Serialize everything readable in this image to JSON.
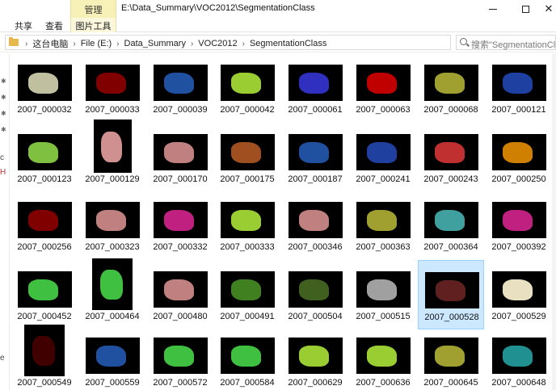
{
  "window": {
    "title": "E:\\Data_Summary\\VOC2012\\SegmentationClass",
    "contextual_group": "管理"
  },
  "ribbon": {
    "tabs": [
      "共享",
      "查看"
    ],
    "contextual_tab": "图片工具"
  },
  "address": {
    "crumbs": [
      "这台电脑",
      "File (E:)",
      "Data_Summary",
      "VOC2012",
      "SegmentationClass"
    ],
    "search_placeholder": "搜索\"SegmentationCla..."
  },
  "left_nav": {
    "fragments": [
      "c",
      "H",
      "e"
    ]
  },
  "files": [
    {
      "name": "2007_000032",
      "thumb": "wide",
      "accent": "#c0c0a0"
    },
    {
      "name": "2007_000033",
      "thumb": "wide",
      "accent": "#800000"
    },
    {
      "name": "2007_000039",
      "thumb": "wide",
      "accent": "#2050a0"
    },
    {
      "name": "2007_000042",
      "thumb": "wide",
      "accent": "#9acd32"
    },
    {
      "name": "2007_000061",
      "thumb": "wide",
      "accent": "#3030c0"
    },
    {
      "name": "2007_000063",
      "thumb": "wide",
      "accent": "#c00000"
    },
    {
      "name": "2007_000068",
      "thumb": "wide",
      "accent": "#a0a030"
    },
    {
      "name": "2007_000121",
      "thumb": "wide",
      "accent": "#1e40a0"
    },
    {
      "name": "2007_000123",
      "thumb": "wide",
      "accent": "#80c040"
    },
    {
      "name": "2007_000129",
      "thumb": "tall",
      "accent": "#d09090"
    },
    {
      "name": "2007_000170",
      "thumb": "wide",
      "accent": "#c08080"
    },
    {
      "name": "2007_000175",
      "thumb": "wide",
      "accent": "#a05020"
    },
    {
      "name": "2007_000187",
      "thumb": "wide",
      "accent": "#2050a0"
    },
    {
      "name": "2007_000241",
      "thumb": "wide",
      "accent": "#2040a0"
    },
    {
      "name": "2007_000243",
      "thumb": "wide",
      "accent": "#c03030"
    },
    {
      "name": "2007_000250",
      "thumb": "wide",
      "accent": "#d08000"
    },
    {
      "name": "2007_000256",
      "thumb": "wide",
      "accent": "#800000"
    },
    {
      "name": "2007_000323",
      "thumb": "wide",
      "accent": "#c08080"
    },
    {
      "name": "2007_000332",
      "thumb": "wide",
      "accent": "#c02080"
    },
    {
      "name": "2007_000333",
      "thumb": "wide",
      "accent": "#9acd32"
    },
    {
      "name": "2007_000346",
      "thumb": "wide",
      "accent": "#c08080"
    },
    {
      "name": "2007_000363",
      "thumb": "wide",
      "accent": "#a0a030"
    },
    {
      "name": "2007_000364",
      "thumb": "wide",
      "accent": "#40a0a0"
    },
    {
      "name": "2007_000392",
      "thumb": "wide",
      "accent": "#c02080"
    },
    {
      "name": "2007_000452",
      "thumb": "wide",
      "accent": "#40c040"
    },
    {
      "name": "2007_000464",
      "thumb": "portrait",
      "accent": "#40c040"
    },
    {
      "name": "2007_000480",
      "thumb": "wide",
      "accent": "#c08080"
    },
    {
      "name": "2007_000491",
      "thumb": "wide",
      "accent": "#408020"
    },
    {
      "name": "2007_000504",
      "thumb": "wide",
      "accent": "#406020"
    },
    {
      "name": "2007_000515",
      "thumb": "wide",
      "accent": "#a0a0a0"
    },
    {
      "name": "2007_000528",
      "thumb": "wide",
      "accent": "#602020",
      "selected": true
    },
    {
      "name": "2007_000529",
      "thumb": "wide",
      "accent": "#e8e0c0"
    },
    {
      "name": "2007_000549",
      "thumb": "portrait",
      "accent": "#400000"
    },
    {
      "name": "2007_000559",
      "thumb": "wide",
      "accent": "#2050a0"
    },
    {
      "name": "2007_000572",
      "thumb": "wide",
      "accent": "#40c040"
    },
    {
      "name": "2007_000584",
      "thumb": "wide",
      "accent": "#40c040"
    },
    {
      "name": "2007_000629",
      "thumb": "wide",
      "accent": "#9acd32"
    },
    {
      "name": "2007_000636",
      "thumb": "wide",
      "accent": "#9acd32"
    },
    {
      "name": "2007_000645",
      "thumb": "wide",
      "accent": "#a0a030"
    },
    {
      "name": "2007_000648",
      "thumb": "wide",
      "accent": "#209090"
    }
  ]
}
